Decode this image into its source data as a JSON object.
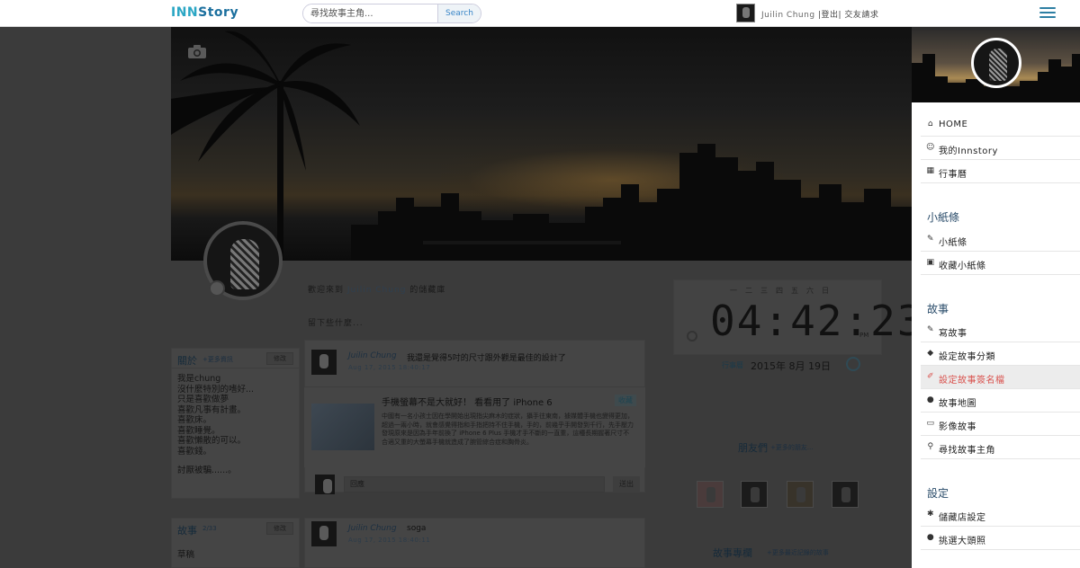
{
  "topbar": {
    "logo_part1": "INN",
    "logo_part2": "Story",
    "search_placeholder": "尋找故事主角...",
    "search_button": "Search",
    "user_name": "Juilin Chung",
    "user_links": " |登出| 交友請求"
  },
  "profile": {
    "welcome_prefix": "歡迎來到 ",
    "welcome_name": "Juilin Chung",
    "welcome_suffix": " 的儲藏庫",
    "leave_message": "留下些什麼...",
    "about": {
      "title": "關於",
      "more_link": "+更多資訊",
      "edit": "修改",
      "lines": [
        "我是chung",
        "沒什麼特別的嗜好...",
        "只是喜歡做夢",
        "喜歡凡事有計畫。",
        "喜歡床。",
        "喜歡睡覺。",
        "喜歡懶散的可以。",
        "喜歡錢。"
      ],
      "signature": "討厭被騙......。"
    },
    "stories": {
      "title": "故事",
      "count": "2/33",
      "edit": "修改",
      "first": "草稿"
    }
  },
  "feed": [
    {
      "author": "Juilin Chung",
      "text": "我還是覺得5吋的尺寸跟外觀是最佳的設計了",
      "time": "Aug 17, 2015 18:40:17",
      "link": {
        "title": "手機螢幕不是大就好！ 看看用了 iPhone 6",
        "desc": "中國有一名小孩士因在學開始出現指尖麻木的症狀，攝手往東南，據媒體手機也變得更加，超過一兩小時，就會感覺得指和手指把持不住手機，手的，前幾乎手開發到千行，先手壓力發現原來是因為手年前換了 iPhone 6 Plus 手機才手不斷的一直重，這種長期握著尺寸不合適又重的大螢幕手機就造成了腕管綜合症和胸骨炎。",
        "collect": "收藏"
      },
      "comment_placeholder": "回應",
      "comment_send": "送出"
    },
    {
      "author": "Juilin Chung",
      "text": "soga",
      "time": "Aug 17, 2015 18:40:11"
    }
  ],
  "widgets": {
    "clock_days": [
      "一",
      "二",
      "三",
      "四",
      "五",
      "六",
      "日"
    ],
    "clock_time": "04:42:23",
    "clock_ampm": "PM",
    "calendar_label": "行事曆",
    "calendar_date": "2015年 8月 19日",
    "friends_title": "朋友們",
    "friends_more": "+更多的朋友...",
    "board_title": "故事專欄",
    "board_more": "+更多最近記錄的故事"
  },
  "sidebar": {
    "main": [
      {
        "icon": "home-icon",
        "glyph": "⌂",
        "label": "HOME"
      },
      {
        "icon": "smile-icon",
        "glyph": "☺",
        "label": "我的Innstory"
      },
      {
        "icon": "calendar-icon",
        "glyph": "▦",
        "label": "行事曆"
      }
    ],
    "notes_title": "小紙條",
    "notes": [
      {
        "icon": "pencil-icon",
        "glyph": "✎",
        "label": "小紙條"
      },
      {
        "icon": "save-icon",
        "glyph": "▣",
        "label": "收藏小紙條"
      }
    ],
    "story_title": "故事",
    "story": [
      {
        "icon": "pencil-icon",
        "glyph": "✎",
        "label": "寫故事"
      },
      {
        "icon": "tags-icon",
        "glyph": "◆",
        "label": "設定故事分類"
      },
      {
        "icon": "edit-icon",
        "glyph": "✐",
        "label": "設定故事簽名檔",
        "active": true
      },
      {
        "icon": "map-marker-icon",
        "glyph": "●",
        "label": "故事地圖"
      },
      {
        "icon": "picture-icon",
        "glyph": "▭",
        "label": "影像故事"
      },
      {
        "icon": "search-icon",
        "glyph": "⚲",
        "label": "尋找故事主角"
      }
    ],
    "settings_title": "設定",
    "settings": [
      {
        "icon": "gear-icon",
        "glyph": "✱",
        "label": "儲藏店設定"
      },
      {
        "icon": "user-icon",
        "glyph": "●",
        "label": "挑選大頭照"
      }
    ],
    "colors": {
      "accent": "#2a4c6a",
      "active": "#d9534f"
    }
  }
}
